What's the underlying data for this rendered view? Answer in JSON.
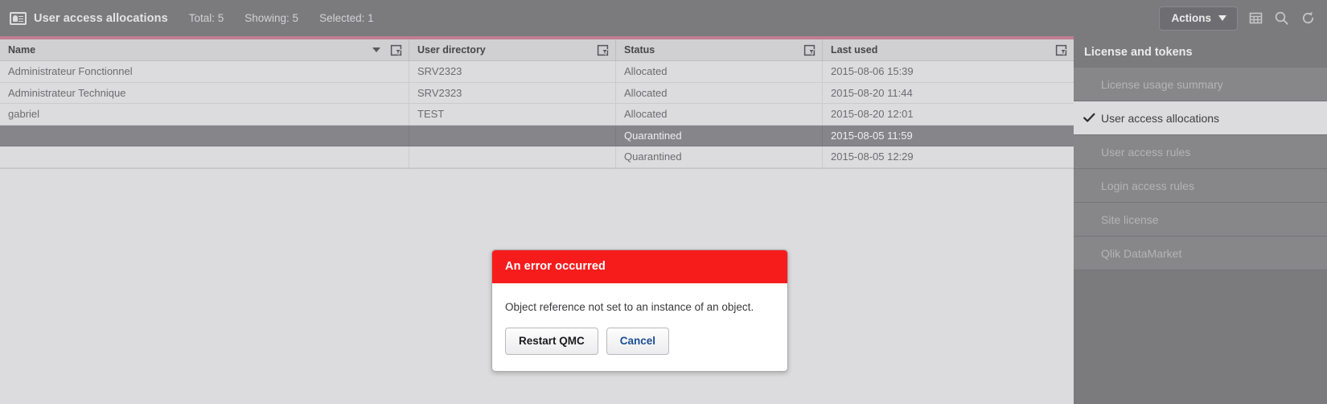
{
  "header": {
    "icon": "id-card-icon",
    "title": "User access allocations",
    "total_label": "Total: 5",
    "showing_label": "Showing: 5",
    "selected_label": "Selected: 1",
    "actions_label": "Actions",
    "icons": [
      "table-columns-icon",
      "search-icon",
      "refresh-icon"
    ],
    "background_color": "#7b7b7e"
  },
  "accent": {
    "color": "#bf7f92"
  },
  "table": {
    "columns": [
      {
        "label": "Name",
        "sorted": true,
        "sort_direction": "desc",
        "filter_icon": "filter-icon"
      },
      {
        "label": "User directory",
        "sorted": false,
        "filter_icon": "filter-icon"
      },
      {
        "label": "Status",
        "sorted": false,
        "filter_icon": "filter-icon"
      },
      {
        "label": "Last used",
        "sorted": false,
        "filter_icon": "filter-icon"
      }
    ],
    "rows": [
      {
        "name": "Administrateur Fonctionnel",
        "user_directory": "SRV2323",
        "status": "Allocated",
        "last_used": "2015-08-06 15:39",
        "selected": false
      },
      {
        "name": "Administrateur Technique",
        "user_directory": "SRV2323",
        "status": "Allocated",
        "last_used": "2015-08-20 11:44",
        "selected": false
      },
      {
        "name": "gabriel",
        "user_directory": "TEST",
        "status": "Allocated",
        "last_used": "2015-08-20 12:01",
        "selected": false
      },
      {
        "name": "",
        "user_directory": "",
        "status": "Quarantined",
        "last_used": "2015-08-05 11:59",
        "selected": true
      },
      {
        "name": "",
        "user_directory": "",
        "status": "Quarantined",
        "last_used": "2015-08-05 12:29",
        "selected": false
      }
    ]
  },
  "sidebar": {
    "title": "License and tokens",
    "items": [
      {
        "label": "License usage summary",
        "active": false
      },
      {
        "label": "User access allocations",
        "active": true
      },
      {
        "label": "User access rules",
        "active": false
      },
      {
        "label": "Login access rules",
        "active": false
      },
      {
        "label": "Site license",
        "active": false
      },
      {
        "label": "Qlik DataMarket",
        "active": false
      }
    ]
  },
  "dialog": {
    "title": "An error occurred",
    "message": "Object reference not set to an instance of an object.",
    "primary_button": "Restart QMC",
    "secondary_button": "Cancel",
    "header_color": "#f61c1c"
  }
}
